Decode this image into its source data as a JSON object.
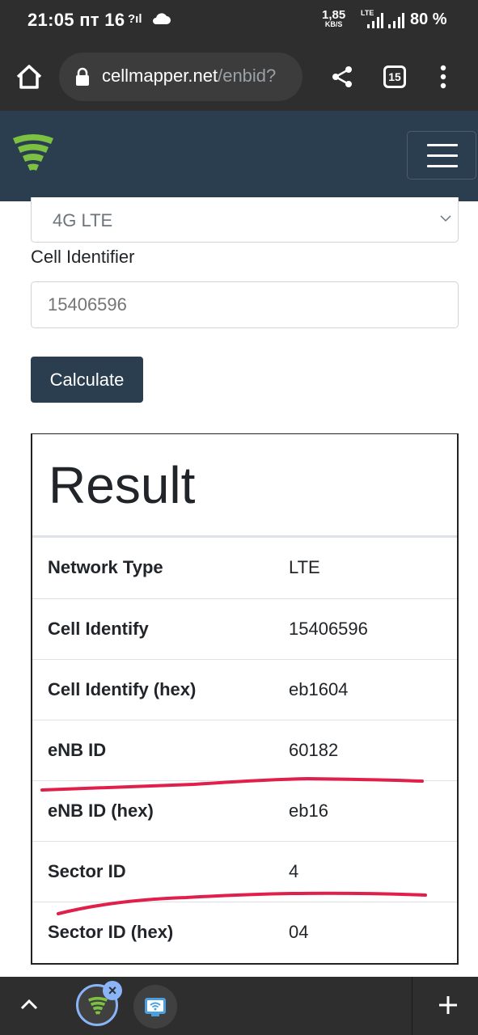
{
  "status_bar": {
    "time": "21:05",
    "date": "пт 16",
    "signal_label": "?ıl",
    "speed_value": "1,85",
    "speed_unit": "KB/S",
    "network_label": "LTE",
    "battery": "80 %"
  },
  "browser": {
    "url_host": "cellmapper.net",
    "url_path": "/enbid?",
    "tab_count": "15"
  },
  "form": {
    "network_select_value": "4G LTE",
    "cell_identifier_label": "Cell Identifier",
    "cell_identifier_placeholder": "15406596",
    "calculate_label": "Calculate"
  },
  "result": {
    "title": "Result",
    "rows": [
      {
        "key": "Network Type",
        "value": "LTE"
      },
      {
        "key": "Cell Identify",
        "value": "15406596"
      },
      {
        "key": "Cell Identify (hex)",
        "value": "eb1604"
      },
      {
        "key": "eNB ID",
        "value": "60182"
      },
      {
        "key": "eNB ID (hex)",
        "value": "eb16"
      },
      {
        "key": "Sector ID",
        "value": "4"
      },
      {
        "key": "Sector ID (hex)",
        "value": "04"
      }
    ]
  },
  "colors": {
    "navbar": "#2b3e50",
    "button": "#2b3e50",
    "annotation": "#e0204a",
    "logo_green": "#7dc142"
  },
  "icons": [
    "home-icon",
    "lock-icon",
    "share-icon",
    "more-vert-icon",
    "hamburger-icon",
    "chevron-down-icon",
    "chevron-up-icon",
    "plus-icon",
    "close-icon",
    "cellmapper-logo-icon",
    "wifi-app-icon"
  ]
}
